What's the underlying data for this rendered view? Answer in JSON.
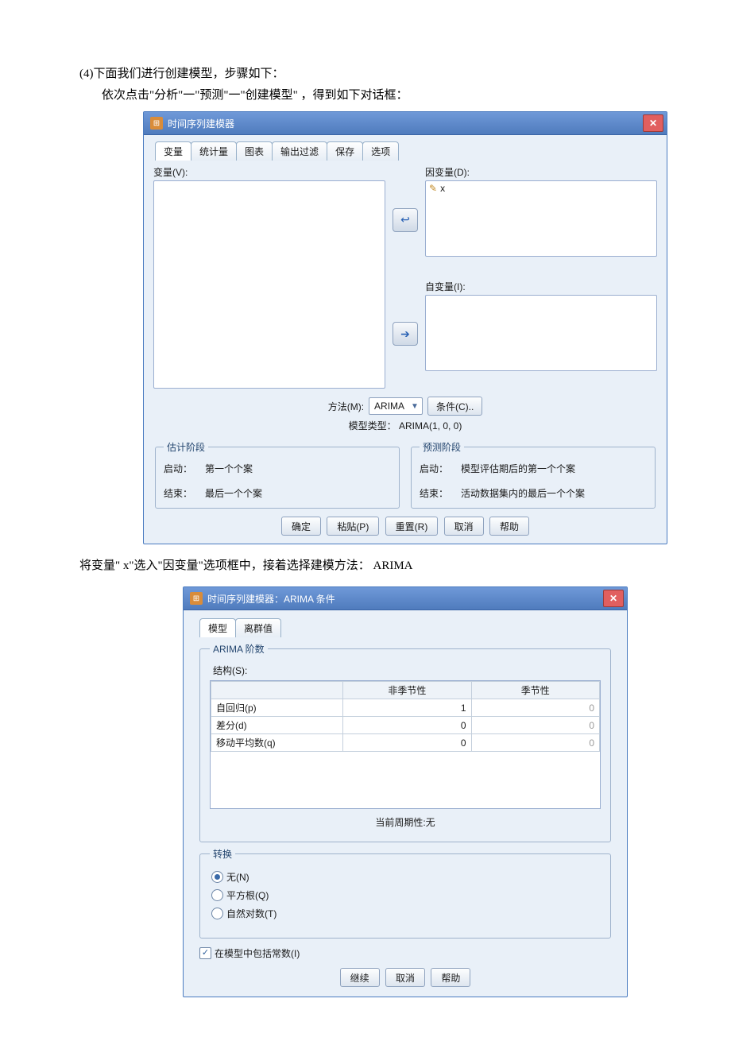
{
  "doc": {
    "line1": "(4)下面我们进行创建模型，步骤如下：",
    "line2": "依次点击\"分析\"一\"预测\"一\"创建模型\"    ，得到如下对话框：",
    "line3": "将变量\" x\"选入\"因变量\"选项框中，接着选择建模方法：    ARIMA"
  },
  "dialog1": {
    "title": "时间序列建模器",
    "tabs": [
      "变量",
      "统计量",
      "图表",
      "输出过滤",
      "保存",
      "选项"
    ],
    "labels": {
      "vars": "变量(V):",
      "dep": "因变量(D):",
      "indep": "自变量(I):",
      "method": "方法(M):",
      "condition": "条件(C)..",
      "model_type": "模型类型：  ARIMA(1, 0, 0)"
    },
    "dep_item": "x",
    "method_value": "ARIMA",
    "est": {
      "legend": "估计阶段",
      "start_k": "启动：",
      "start_v": "第一个个案",
      "end_k": "结束：",
      "end_v": "最后一个个案"
    },
    "pred": {
      "legend": "预测阶段",
      "start_k": "启动：",
      "start_v": "模型评估期后的第一个个案",
      "end_k": "结束：",
      "end_v": "活动数据集内的最后一个个案"
    },
    "buttons": {
      "ok": "确定",
      "paste": "粘贴(P)",
      "reset": "重置(R)",
      "cancel": "取消",
      "help": "帮助"
    }
  },
  "dialog2": {
    "title": "时间序列建模器：ARIMA 条件",
    "tabs": [
      "模型",
      "离群值"
    ],
    "order_legend": "ARIMA 阶数",
    "struct_label": "结构(S):",
    "cols": {
      "nonseasonal": "非季节性",
      "seasonal": "季节性"
    },
    "rows": [
      {
        "name": "自回归(p)",
        "ns": "1",
        "s": "0"
      },
      {
        "name": "差分(d)",
        "ns": "0",
        "s": "0"
      },
      {
        "name": "移动平均数(q)",
        "ns": "0",
        "s": "0"
      }
    ],
    "period": "当前周期性:无",
    "transform": {
      "legend": "转换",
      "none": "无(N)",
      "sqrt": "平方根(Q)",
      "log": "自然对数(T)"
    },
    "include_const": "在模型中包括常数(I)",
    "buttons": {
      "continue": "继续",
      "cancel": "取消",
      "help": "帮助"
    }
  }
}
